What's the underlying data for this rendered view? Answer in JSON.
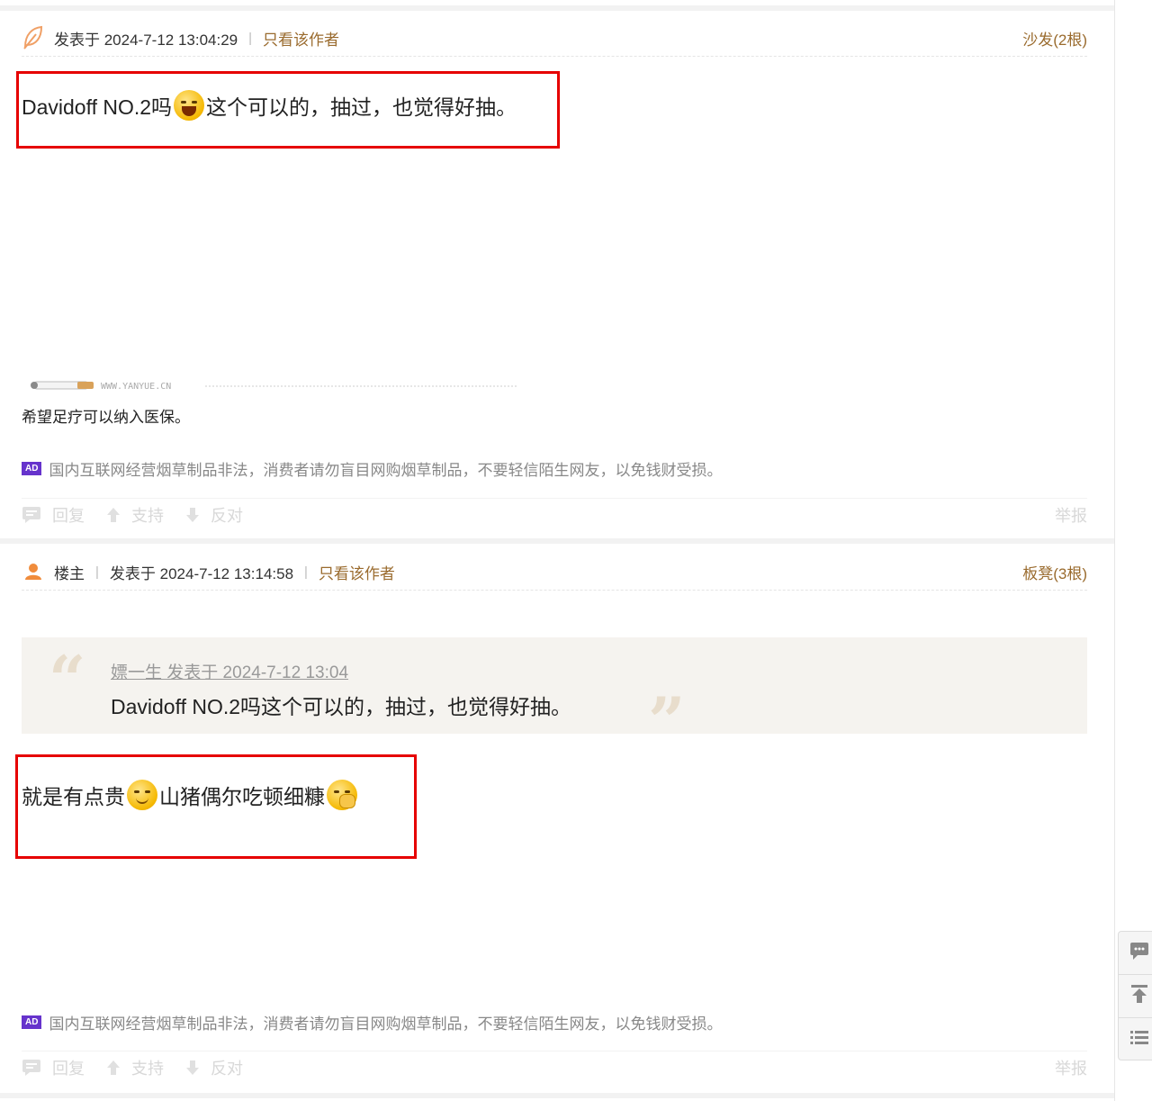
{
  "post1": {
    "icon": "leaf-icon",
    "date_text": "发表于 2024-7-12 13:04:29",
    "only_author": "只看该作者",
    "floor": "沙发(2根)",
    "content_before": "Davidoff NO.2吗",
    "content_after": "这个可以的，抽过，也觉得好抽。",
    "signature_watermark": "WWW.YANYUE.CN",
    "signature_text": "希望足疗可以纳入医保。",
    "ad_badge": "AD",
    "ad_text": "国内互联网经营烟草制品非法，消费者请勿盲目网购烟草制品，不要轻信陌生网友，以免钱财受损。",
    "actions": {
      "reply": "回复",
      "support": "支持",
      "oppose": "反对",
      "report": "举报"
    }
  },
  "post2": {
    "icon": "user-icon",
    "author_role": "楼主",
    "date_text": "发表于 2024-7-12 13:14:58",
    "only_author": "只看该作者",
    "floor": "板凳(3根)",
    "quote": {
      "author_line": "嫖一生 发表于 2024-7-12 13:04",
      "text": "Davidoff NO.2吗这个可以的，抽过，也觉得好抽。"
    },
    "content_before": "就是有点贵",
    "content_middle": "山猪偶尔吃顿细糠",
    "ad_badge": "AD",
    "ad_text": "国内互联网经营烟草制品非法，消费者请勿盲目网购烟草制品，不要轻信陌生网友，以免钱财受损。",
    "actions": {
      "reply": "回复",
      "support": "支持",
      "oppose": "反对",
      "report": "举报"
    }
  },
  "colors": {
    "link": "#9a6b2e",
    "highlight_box": "#e60000",
    "ad_badge": "#6633cc"
  }
}
